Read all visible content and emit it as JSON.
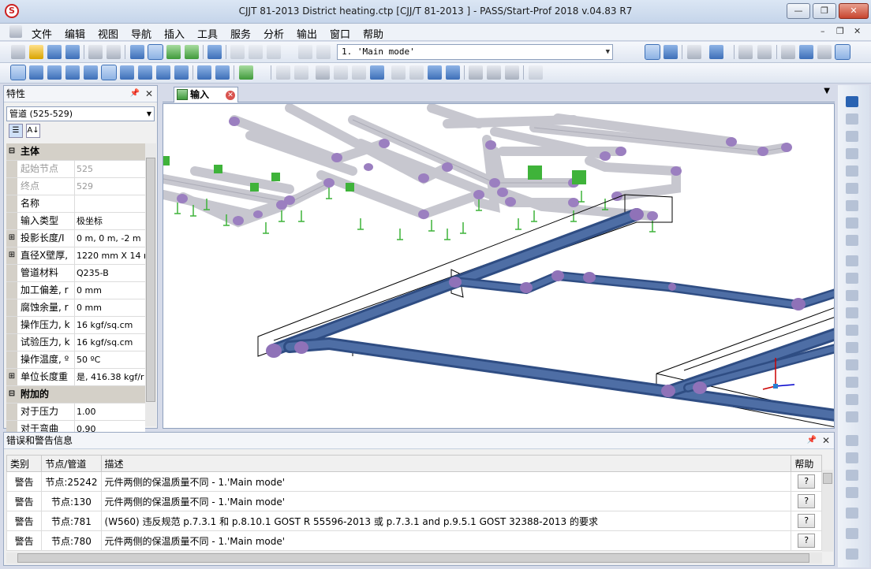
{
  "window": {
    "title": "CJJT 81-2013 District heating.ctp [CJJ/T 81-2013 ] - PASS/Start-Prof 2018 v.04.83 R7",
    "minimize": "—",
    "maximize": "❐",
    "close": "✕"
  },
  "menu": {
    "items": [
      "文件",
      "编辑",
      "视图",
      "导航",
      "插入",
      "工具",
      "服务",
      "分析",
      "输出",
      "窗口",
      "帮助"
    ],
    "mdi_min": "–",
    "mdi_restore": "❐",
    "mdi_close": "✕"
  },
  "toolbar": {
    "mode_value": "1. 'Main mode'"
  },
  "properties": {
    "title": "特性",
    "selector": "管道 (525-529)",
    "rows": [
      {
        "type": "cat",
        "gutter": "⊟",
        "key": "主体",
        "value": ""
      },
      {
        "type": "dis",
        "gutter": "",
        "key": "起始节点",
        "value": "525"
      },
      {
        "type": "dis",
        "gutter": "",
        "key": "终点",
        "value": "529"
      },
      {
        "type": "row",
        "gutter": "",
        "key": "名称",
        "value": ""
      },
      {
        "type": "row",
        "gutter": "",
        "key": "输入类型",
        "value": "极坐标"
      },
      {
        "type": "row",
        "gutter": "⊞",
        "key": "投影长度/I",
        "value": "0 m, 0 m, -2 m"
      },
      {
        "type": "row",
        "gutter": "⊞",
        "key": "直径X壁厚,",
        "value": "1220 mm X 14 m"
      },
      {
        "type": "row",
        "gutter": "",
        "key": "管道材料",
        "value": "Q235-B"
      },
      {
        "type": "row",
        "gutter": "",
        "key": "加工偏差, r",
        "value": "0 mm"
      },
      {
        "type": "row",
        "gutter": "",
        "key": "腐蚀余量, r",
        "value": "0 mm"
      },
      {
        "type": "row",
        "gutter": "",
        "key": "操作压力, k",
        "value": "16 kgf/sq.cm"
      },
      {
        "type": "row",
        "gutter": "",
        "key": "试验压力, k",
        "value": "16 kgf/sq.cm"
      },
      {
        "type": "row",
        "gutter": "",
        "key": "操作温度, º",
        "value": "50 ºC"
      },
      {
        "type": "row",
        "gutter": "⊞",
        "key": "单位长度重",
        "value": "是, 416.38 kgf/r"
      },
      {
        "type": "cat",
        "gutter": "⊟",
        "key": "附加的",
        "value": ""
      },
      {
        "type": "row",
        "gutter": "",
        "key": "对于压力",
        "value": "1.00"
      },
      {
        "type": "row",
        "gutter": "",
        "key": "对于弯曲",
        "value": "0.90"
      }
    ]
  },
  "viewport": {
    "tab_label": "输入"
  },
  "errors": {
    "title": "错误和警告信息",
    "columns": [
      "类别",
      "节点/管道",
      "描述",
      "帮助"
    ],
    "rows": [
      {
        "category": "警告",
        "node": "节点:25242",
        "desc": "元件两侧的保温质量不同 - 1.'Main mode'",
        "help": "?"
      },
      {
        "category": "警告",
        "node": "节点:130",
        "desc": "元件两侧的保温质量不同 - 1.'Main mode'",
        "help": "?"
      },
      {
        "category": "警告",
        "node": "节点:781",
        "desc": "(W560) 违反规范 p.7.3.1 和 p.8.10.1 GOST R 55596-2013 或 p.7.3.1 and p.9.5.1 GOST 32388-2013 的要求",
        "help": "?"
      },
      {
        "category": "警告",
        "node": "节点:780",
        "desc": "元件两侧的保温质量不同 - 1.'Main mode'",
        "help": "?"
      }
    ]
  }
}
